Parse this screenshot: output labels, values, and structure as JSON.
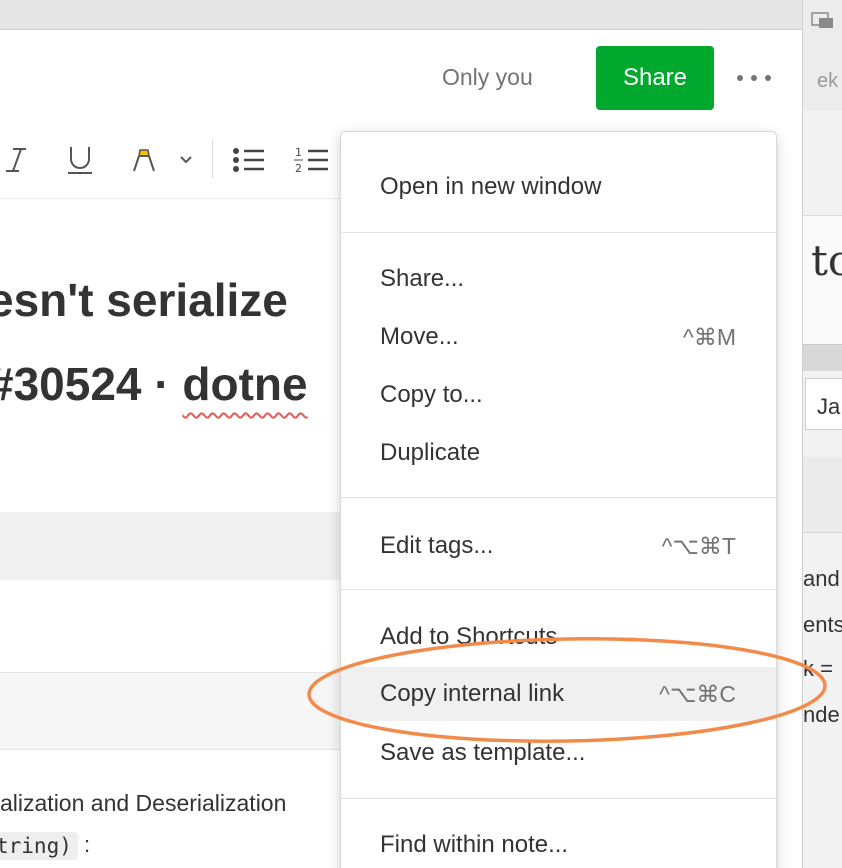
{
  "header": {
    "visibility_label": "Only you",
    "share_label": "Share",
    "accent_color": "#00a82d"
  },
  "toolbar": {
    "icons": [
      "italic-icon",
      "underline-icon",
      "highlighter-icon",
      "chevron-down-icon",
      "bulleted-list-icon",
      "numbered-list-icon"
    ],
    "italic_glyph": "I",
    "underline_glyph": "U"
  },
  "note": {
    "title_line1": "esn't serialize",
    "title_line2_prefix": "#30524 · ",
    "title_line2_word": "dotne",
    "body_text": "alization and Deserialization",
    "code_snippet": "tring)",
    "code_suffix": ":"
  },
  "menu": {
    "groups": [
      [
        {
          "label": "Open in new window",
          "shortcut": ""
        }
      ],
      [
        {
          "label": "Share...",
          "shortcut": ""
        },
        {
          "label": "Move...",
          "shortcut": "^⌘M"
        },
        {
          "label": "Copy to...",
          "shortcut": ""
        },
        {
          "label": "Duplicate",
          "shortcut": ""
        }
      ],
      [
        {
          "label": "Edit tags...",
          "shortcut": "^⌥⌘T"
        }
      ],
      [
        {
          "label": "Add to Shortcuts",
          "shortcut": ""
        },
        {
          "label": "Copy internal link",
          "shortcut": "^⌥⌘C",
          "highlighted": true
        },
        {
          "label": "Save as template...",
          "shortcut": ""
        }
      ],
      [
        {
          "label": "Find within note...",
          "shortcut": ""
        }
      ]
    ]
  },
  "background_window": {
    "peek_tab": "ek (!",
    "peek_title": "to",
    "peek_field": "Ja",
    "peek_lines": [
      "and",
      "ents",
      "k =",
      "nde"
    ]
  },
  "annotation": {
    "color": "#f28a4a",
    "target": "Copy internal link"
  }
}
